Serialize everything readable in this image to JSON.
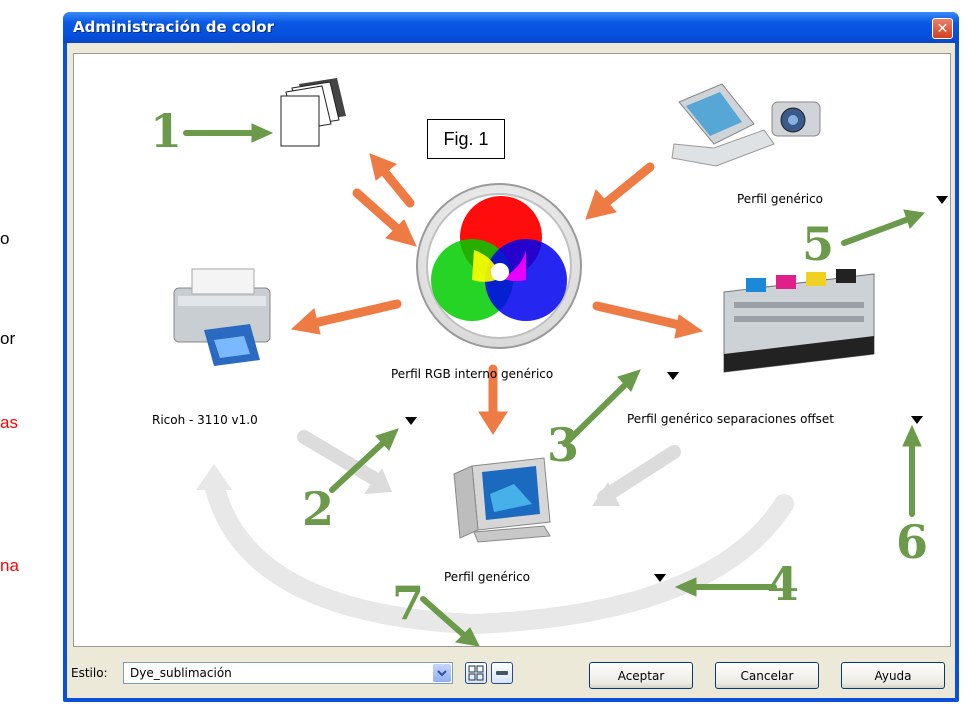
{
  "side_texts": [
    "o",
    "or",
    "as",
    "na"
  ],
  "fig_label": "Fig. 1",
  "window": {
    "title": "Administración de color",
    "close_glyph": "✕"
  },
  "canvas": {
    "labels": {
      "rgb_profile": "Perfil RGB interno genérico",
      "printer_profile": "Ricoh - 3110 v1.0",
      "scanner_profile": "Perfil genérico",
      "offset_profile": "Perfil genérico separaciones offset",
      "monitor_profile": "Perfil genérico"
    },
    "step_numbers": [
      "1",
      "2",
      "3",
      "4",
      "5",
      "6",
      "7"
    ]
  },
  "bottom": {
    "estilo_label": "Estilo:",
    "estilo_value": "Dye_sublimación",
    "accept": "Aceptar",
    "cancel": "Cancelar",
    "help": "Ayuda"
  },
  "colors": {
    "green_arrow": "#6a9a4a",
    "orange_arrow": "#ee7a44",
    "side_red": "#ff0000"
  },
  "icons": [
    "documents-icon",
    "scanner-camera-icon",
    "color-wheel-icon",
    "printer-icon",
    "press-icon",
    "monitor-icon",
    "flow-arrows-icon",
    "dropdown-arrow-icon"
  ]
}
